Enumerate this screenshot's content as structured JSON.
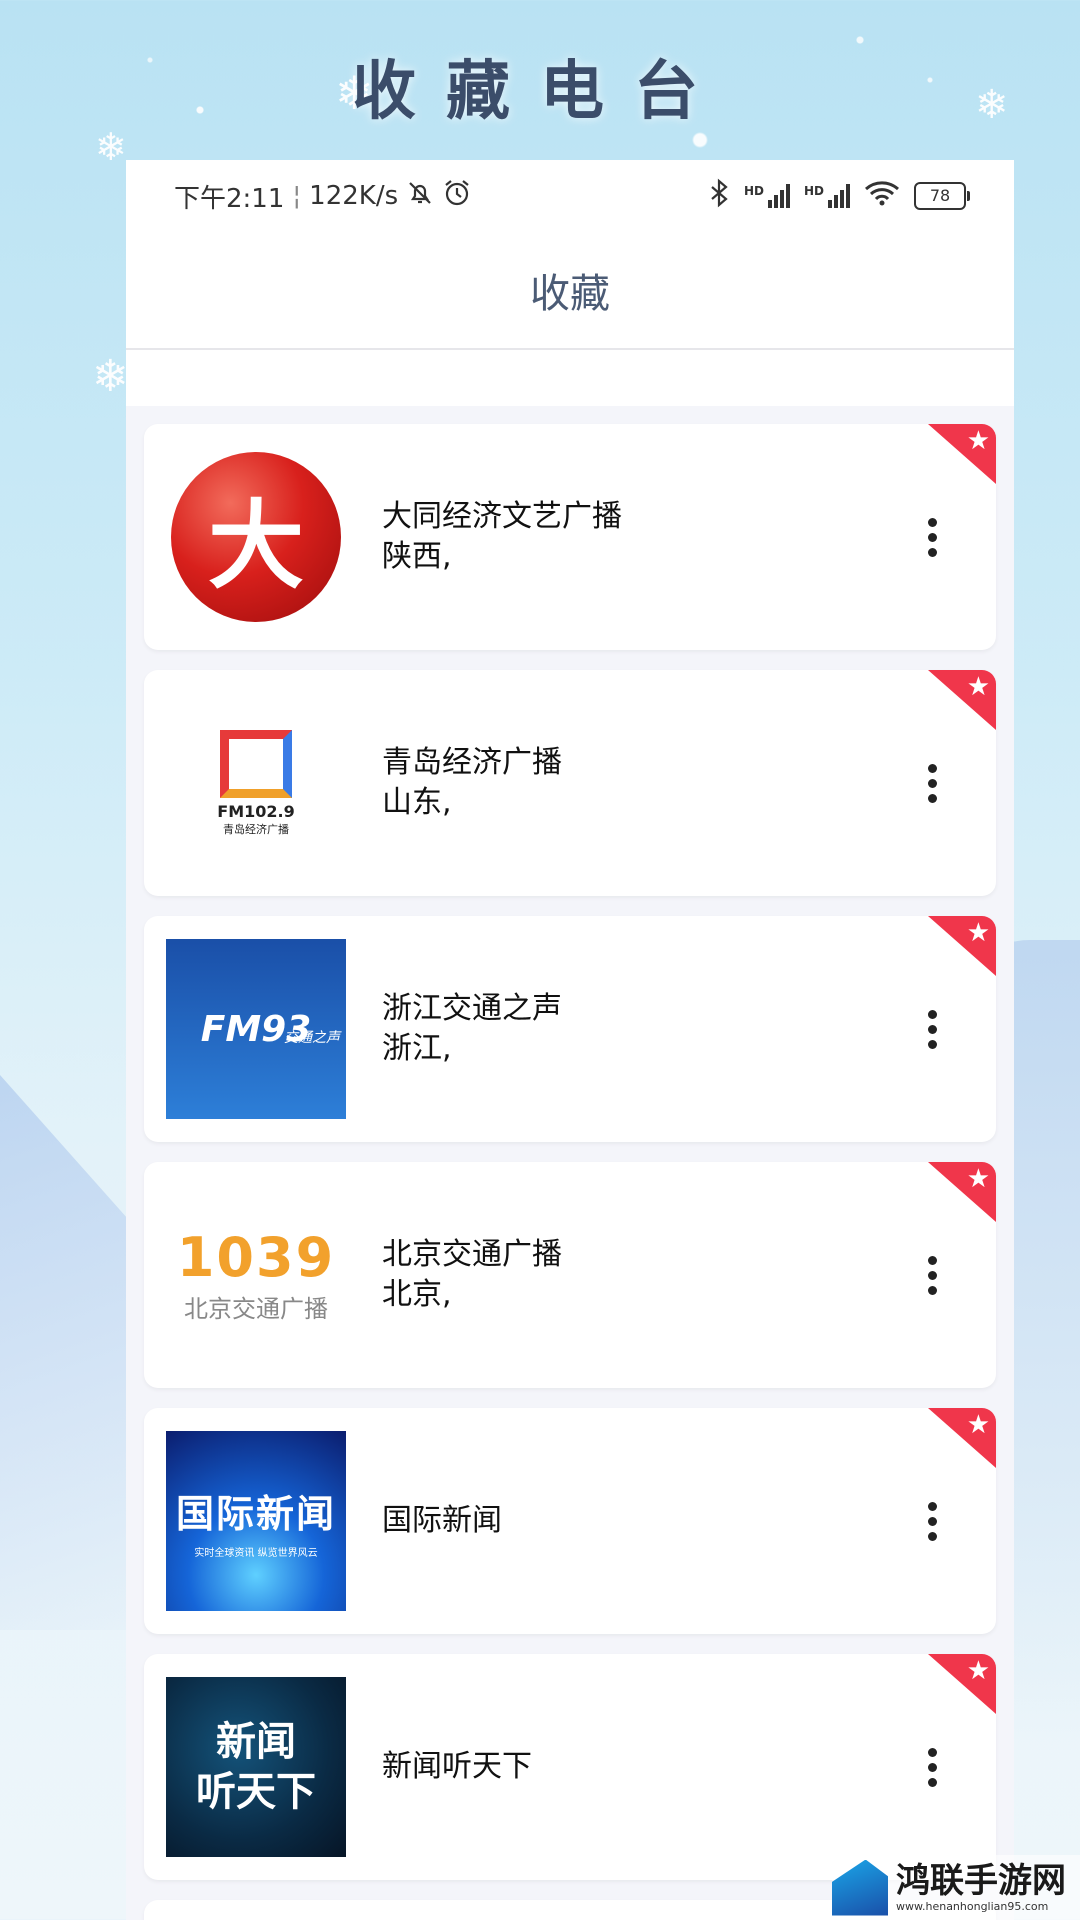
{
  "page": {
    "title": "收藏电台"
  },
  "status_bar": {
    "time": "下午2:11",
    "speed": "122K/s",
    "separator": "¦",
    "hd_label_1": "HD",
    "hd_label_2": "HD",
    "battery": "78"
  },
  "app_bar": {
    "title": "收藏"
  },
  "stations": [
    {
      "name": "大同经济文艺广播",
      "region": "陕西,",
      "thumb_text": "大"
    },
    {
      "name": "青岛经济广播",
      "region": "山东,",
      "thumb_text": "FM102.9",
      "thumb_sub": "青岛经济广播"
    },
    {
      "name": "浙江交通之声",
      "region": "浙江,",
      "thumb_text": "FM93",
      "thumb_sub": "交通之声"
    },
    {
      "name": "北京交通广播",
      "region": "北京,",
      "thumb_text": "1039",
      "thumb_sub": "北京交通广播"
    },
    {
      "name": "国际新闻",
      "region": "",
      "thumb_text": "国际新闻",
      "thumb_sub": "实时全球资讯 纵览世界风云"
    },
    {
      "name": "新闻听天下",
      "region": "",
      "thumb_text_1": "新闻",
      "thumb_text_2": "听天下"
    }
  ],
  "watermark": {
    "name": "鸿联手游网",
    "url": "www.henanhonglian95.com"
  },
  "colors": {
    "ribbon": "#f0364b",
    "title": "#3b4d6a",
    "app_bar_title": "#4b5b75"
  }
}
